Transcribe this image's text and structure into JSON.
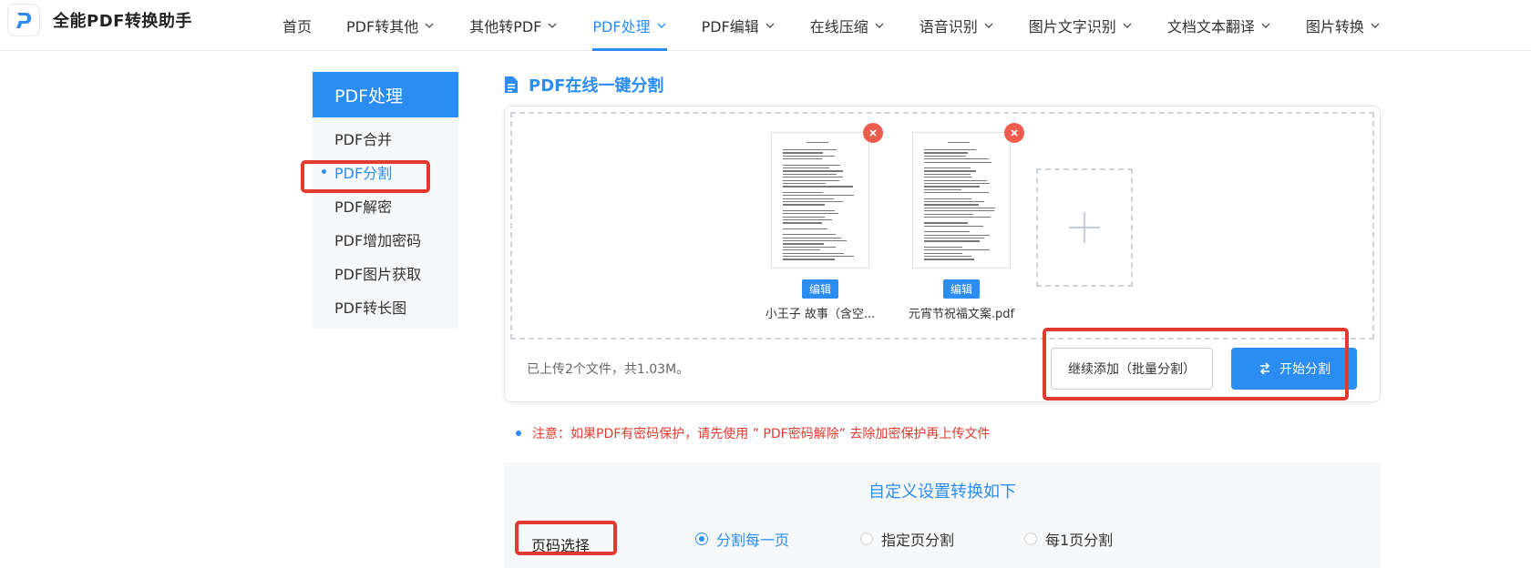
{
  "header": {
    "brand": "全能PDF转换助手",
    "nav": [
      {
        "label": "首页",
        "has_menu": false
      },
      {
        "label": "PDF转其他",
        "has_menu": true
      },
      {
        "label": "其他转PDF",
        "has_menu": true
      },
      {
        "label": "PDF处理",
        "has_menu": true,
        "active": true
      },
      {
        "label": "PDF编辑",
        "has_menu": true
      },
      {
        "label": "在线压缩",
        "has_menu": true
      },
      {
        "label": "语音识别",
        "has_menu": true
      },
      {
        "label": "图片文字识别",
        "has_menu": true
      },
      {
        "label": "文档文本翻译",
        "has_menu": true
      },
      {
        "label": "图片转换",
        "has_menu": true
      }
    ]
  },
  "sidebar": {
    "title": "PDF处理",
    "items": [
      {
        "label": "PDF合并"
      },
      {
        "label": "PDF分割",
        "active": true
      },
      {
        "label": "PDF解密"
      },
      {
        "label": "PDF增加密码"
      },
      {
        "label": "PDF图片获取"
      },
      {
        "label": "PDF转长图"
      }
    ]
  },
  "main": {
    "title": "PDF在线一键分割",
    "files": [
      {
        "name": "小王子 故事（含空...",
        "edit_label": "编辑"
      },
      {
        "name": "元宵节祝福文案.pdf",
        "edit_label": "编辑"
      }
    ],
    "upload_status": "已上传2个文件，共1.03M。",
    "continue_button": "继续添加（批量分割）",
    "start_button": "开始分割",
    "notice": "注意：如果PDF有密码保护，请先使用 ” PDF密码解除” 去除加密保护再上传文件"
  },
  "settings": {
    "title": "自定义设置转换如下",
    "label": "页码选择",
    "options": [
      {
        "label": "分割每一页",
        "checked": true
      },
      {
        "label": "指定页分割",
        "checked": false
      },
      {
        "label": "每1页分割",
        "checked": false
      }
    ]
  },
  "colors": {
    "accent": "#2b8df2",
    "highlight": "#e23a2e",
    "remove": "#ef5b4c"
  }
}
